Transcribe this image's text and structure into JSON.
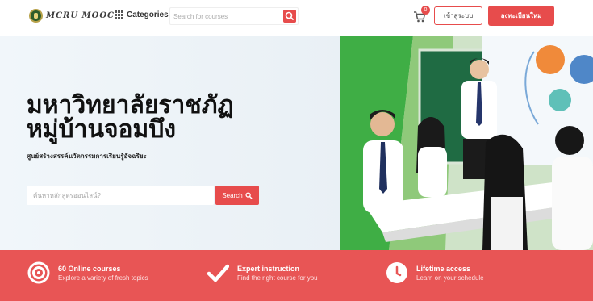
{
  "header": {
    "logo_text": "MCRU MOOC",
    "categories_label": "Categories",
    "search_placeholder": "Search for courses",
    "cart_count": "0",
    "login_label": "เข้าสู่ระบบ",
    "register_label": "ลงทะเบียนใหม่"
  },
  "hero": {
    "title_line1": "มหาวิทยาลัยราชภัฏ",
    "title_line2": "หมู่บ้านจอมบึง",
    "subtitle": "ศูนย์สร้างสรรค์นวัตกรรมการเรียนรู้อัจฉริยะ",
    "search_placeholder": "ค้นหาหลักสูตรออนไลน์?",
    "search_button": "Search"
  },
  "features": [
    {
      "title": "60 Online courses",
      "desc": "Explore a variety of fresh topics",
      "icon": "target-icon"
    },
    {
      "title": "Expert instruction",
      "desc": "Find the right course for you",
      "icon": "check-icon"
    },
    {
      "title": "Lifetime access",
      "desc": "Learn on your schedule",
      "icon": "clock-icon"
    }
  ],
  "colors": {
    "accent": "#e74c4c",
    "band": "#e85555",
    "board_green": "#1f7a4a"
  }
}
